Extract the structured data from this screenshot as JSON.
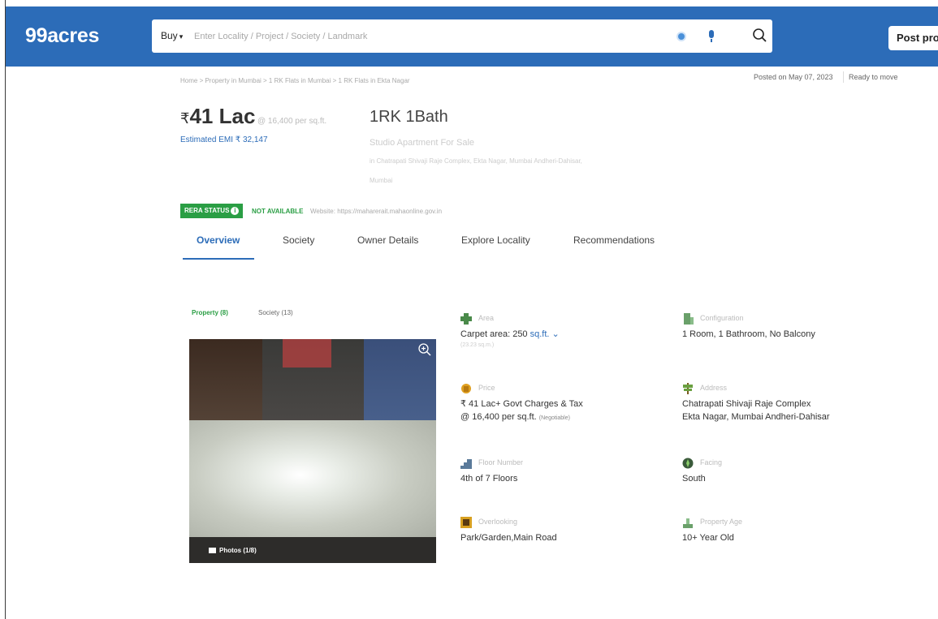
{
  "header": {
    "logo": "99acres",
    "buy_label": "Buy",
    "search_placeholder": "Enter Locality / Project / Society / Landmark",
    "post_button": "Post property"
  },
  "breadcrumb": "Home > Property in Mumbai > 1 RK Flats in Mumbai > 1 RK Flats in Ekta Nagar",
  "meta": {
    "posted": "Posted on May 07, 2023",
    "status": "Ready to move"
  },
  "listing": {
    "currency": "₹",
    "price": "41 Lac",
    "per_sqft": "@ 16,400 per sq.ft.",
    "emi": "Estimated EMI ₹ 32,147",
    "config": "1RK 1Bath",
    "type": "Studio Apartment For Sale",
    "address_line1": "in Chatrapati Shivaji Raje Complex, Ekta Nagar, Mumbai Andheri-Dahisar,",
    "address_line2": "Mumbai"
  },
  "rera": {
    "badge": "RERA STATUS",
    "status": "NOT AVAILABLE",
    "website": "Website: https://maharerait.mahaonline.gov.in"
  },
  "tabs": [
    "Overview",
    "Society",
    "Owner Details",
    "Explore Locality",
    "Recommendations"
  ],
  "gallery": {
    "subtab_property": "Property (8)",
    "subtab_society": "Society (13)",
    "photos_label": "Photos (1/8)"
  },
  "details": {
    "area": {
      "label": "Area",
      "value": "Carpet area: 250",
      "unit": "sq.ft.",
      "sub": "(23.23 sq.m.)"
    },
    "configuration": {
      "label": "Configuration",
      "value": "1 Room, 1 Bathroom, No Balcony"
    },
    "price": {
      "label": "Price",
      "value1": "₹ 41 Lac+ Govt Charges & Tax",
      "value2": "@ 16,400 per sq.ft.",
      "negotiable": "(Negotiable)"
    },
    "address": {
      "label": "Address",
      "value1": "Chatrapati Shivaji Raje Complex",
      "value2": "Ekta Nagar, Mumbai Andheri-Dahisar"
    },
    "floor": {
      "label": "Floor Number",
      "value": "4th of 7 Floors"
    },
    "facing": {
      "label": "Facing",
      "value": "South"
    },
    "overlooking": {
      "label": "Overlooking",
      "value": "Park/Garden,Main Road"
    },
    "age": {
      "label": "Property Age",
      "value": "10+ Year Old"
    }
  },
  "colors": {
    "brand": "#2c6cb8",
    "rera_green": "#2a9e44"
  }
}
